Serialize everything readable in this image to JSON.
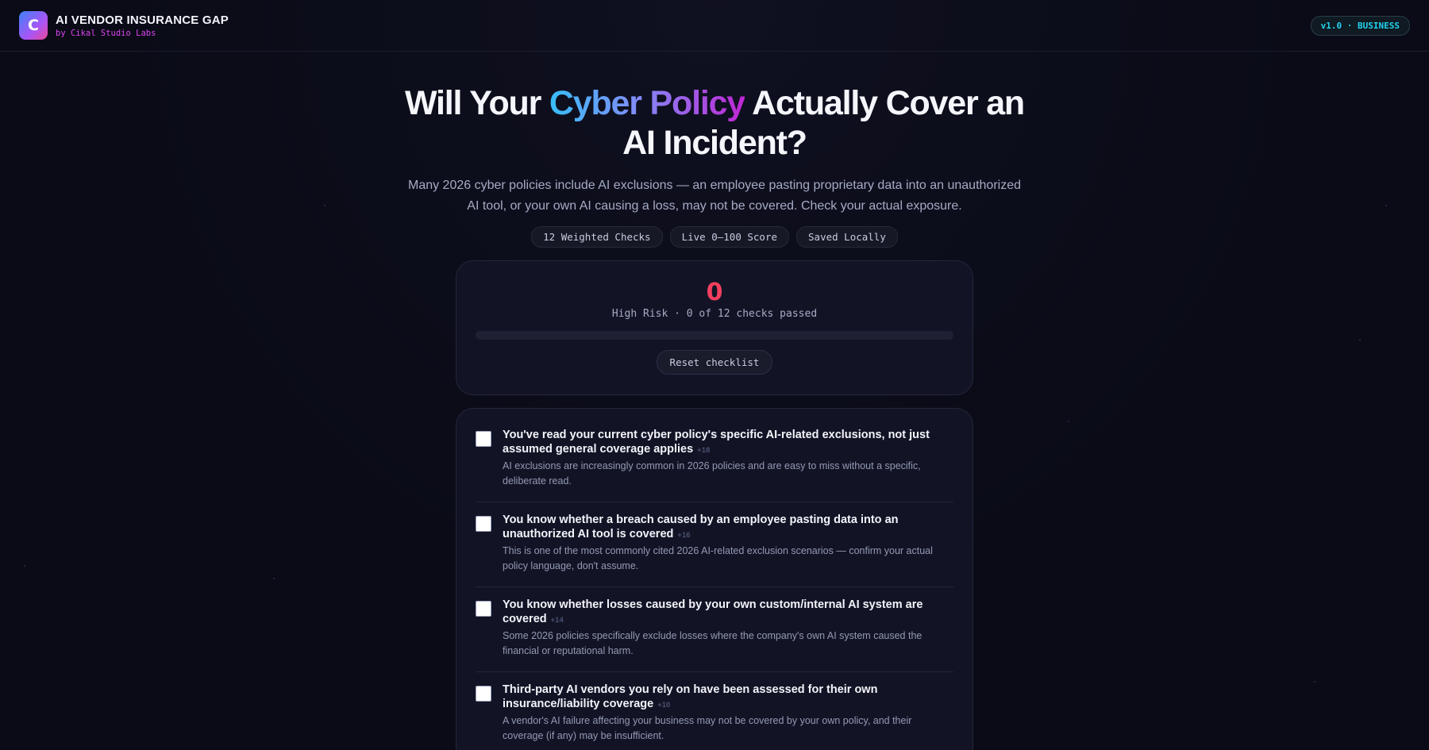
{
  "header": {
    "logo_letter": "C",
    "title": "AI VENDOR INSURANCE GAP",
    "subtitle": "by Cikal Studio Labs",
    "version": "v1.0 · BUSINESS"
  },
  "hero": {
    "headline_pre": "Will Your ",
    "headline_highlight": "Cyber Policy",
    "headline_post": " Actually Cover an AI Incident?",
    "lede": "Many 2026 cyber policies include AI exclusions — an employee pasting proprietary data into an unauthorized AI tool, or your own AI causing a loss, may not be covered. Check your actual exposure.",
    "pills": [
      "12 Weighted Checks",
      "Live 0–100 Score",
      "Saved Locally"
    ]
  },
  "score": {
    "value": "0",
    "status": "High Risk · 0 of 12 checks passed",
    "progress": 0,
    "reset_label": "Reset checklist"
  },
  "checklist": [
    {
      "title": "You've read your current cyber policy's specific AI-related exclusions, not just assumed general coverage applies",
      "weight": "+18",
      "desc": "AI exclusions are increasingly common in 2026 policies and are easy to miss without a specific, deliberate read.",
      "checked": false
    },
    {
      "title": "You know whether a breach caused by an employee pasting data into an unauthorized AI tool is covered",
      "weight": "+16",
      "desc": "This is one of the most commonly cited 2026 AI-related exclusion scenarios — confirm your actual policy language, don't assume.",
      "checked": false
    },
    {
      "title": "You know whether losses caused by your own custom/internal AI system are covered",
      "weight": "+14",
      "desc": "Some 2026 policies specifically exclude losses where the company's own AI system caused the financial or reputational harm.",
      "checked": false
    },
    {
      "title": "Third-party AI vendors you rely on have been assessed for their own insurance/liability coverage",
      "weight": "+10",
      "desc": "A vendor's AI failure affecting your business may not be covered by your own policy, and their coverage (if any) may be insufficient.",
      "checked": false
    }
  ],
  "colors": {
    "background": "#0a0b16",
    "accent_cyan": "#22d3ee",
    "accent_magenta": "#d946ef",
    "risk_red": "#f43f5e"
  }
}
